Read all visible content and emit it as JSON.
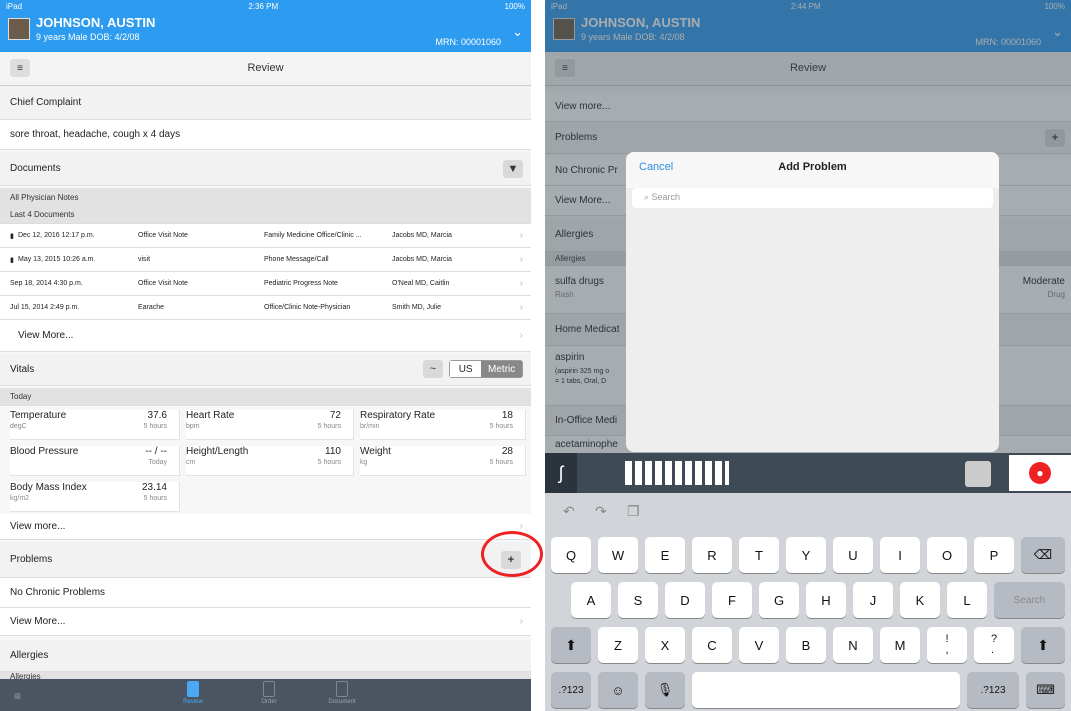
{
  "left": {
    "status": {
      "carrier": "iPad",
      "time": "2:36 PM",
      "battery": "100%"
    },
    "patient": {
      "name": "JOHNSON, AUSTIN",
      "demo": "9 years  Male  DOB: 4/2/08",
      "mrn": "MRN: 00001060"
    },
    "nav_title": "Review",
    "chief_complaint": {
      "header": "Chief Complaint",
      "text": "sore throat, headache, cough x 4 days"
    },
    "documents": {
      "header": "Documents",
      "group1": "All Physician Notes",
      "group2": "Last 4 Documents",
      "rows": [
        {
          "date": "Dec 12, 2016 12:17 p.m.",
          "type": "Office Visit Note",
          "category": "Family Medicine Office/Clinic ...",
          "author": "Jacobs MD, Marcia"
        },
        {
          "date": "May 13, 2015 10:26 a.m.",
          "type": "visit",
          "category": "Phone Message/Call",
          "author": "Jacobs MD, Marcia"
        },
        {
          "date": "Sep 18, 2014 4:30 p.m.",
          "type": "Office Visit Note",
          "category": "Pediatric Progress Note",
          "author": "O'Neal MD, Caitlin"
        },
        {
          "date": "Jul 15, 2014 2:49 p.m.",
          "type": "Earache",
          "category": "Office/Clinic Note-Physician",
          "author": "Smith MD, Julie"
        }
      ],
      "view_more": "View More..."
    },
    "vitals": {
      "header": "Vitals",
      "us": "US",
      "metric": "Metric",
      "today": "Today",
      "cells": [
        {
          "label": "Temperature",
          "unit": "degC",
          "value": "37.6",
          "time": "5 hours"
        },
        {
          "label": "Heart Rate",
          "unit": "bpm",
          "value": "72",
          "time": "5 hours"
        },
        {
          "label": "Respiratory Rate",
          "unit": "br/min",
          "value": "18",
          "time": "5 hours"
        },
        {
          "label": "Blood Pressure",
          "unit": "",
          "value": "-- / --",
          "time": "Today"
        },
        {
          "label": "Height/Length",
          "unit": "cm",
          "value": "110",
          "time": "5 hours"
        },
        {
          "label": "Weight",
          "unit": "kg",
          "value": "28",
          "time": "5 hours"
        },
        {
          "label": "Body Mass Index",
          "unit": "kg/m2",
          "value": "23.14",
          "time": "5 hours"
        }
      ],
      "view_more": "View more..."
    },
    "problems": {
      "header": "Problems",
      "none": "No Chronic Problems",
      "view_more": "View More..."
    },
    "allergies": {
      "header": "Allergies",
      "sub": "Allergies"
    },
    "tabs": [
      {
        "label": "Review"
      },
      {
        "label": "Order"
      },
      {
        "label": "Document"
      }
    ]
  },
  "right": {
    "status": {
      "carrier": "iPad",
      "time": "2:44 PM",
      "battery": "100%"
    },
    "patient": {
      "name": "JOHNSON, AUSTIN",
      "demo": "9 years  Male  DOB: 4/2/08",
      "mrn": "MRN: 00001060"
    },
    "nav_title": "Review",
    "rows": {
      "view_more1": "View more...",
      "problems": "Problems",
      "no_chronic": "No Chronic Pr",
      "view_more2": "View More...",
      "allergies": "Allergies",
      "allergies_sub": "Allergies",
      "allergy_name": "sulfa drugs",
      "allergy_reaction": "Rash",
      "severity": "Moderate",
      "severity_type": "Drug",
      "home_meds": "Home Medicat",
      "med_name": "aspirin",
      "med_detail1": "(aspirin 325 mg o",
      "med_detail2": "= 1 tabs, Oral, D",
      "in_office": "In-Office Medi",
      "acet": "acetaminophe"
    },
    "modal": {
      "cancel": "Cancel",
      "title": "Add Problem",
      "search_placeholder": "Search"
    },
    "keyboard": {
      "row1": [
        "Q",
        "W",
        "E",
        "R",
        "T",
        "Y",
        "U",
        "I",
        "O",
        "P"
      ],
      "row2": [
        "A",
        "S",
        "D",
        "F",
        "G",
        "H",
        "J",
        "K",
        "L"
      ],
      "row3": [
        "Z",
        "X",
        "C",
        "V",
        "B",
        "N",
        "M",
        "!\n,",
        "?\n."
      ],
      "search": "Search",
      "numbers": ".?123"
    }
  }
}
